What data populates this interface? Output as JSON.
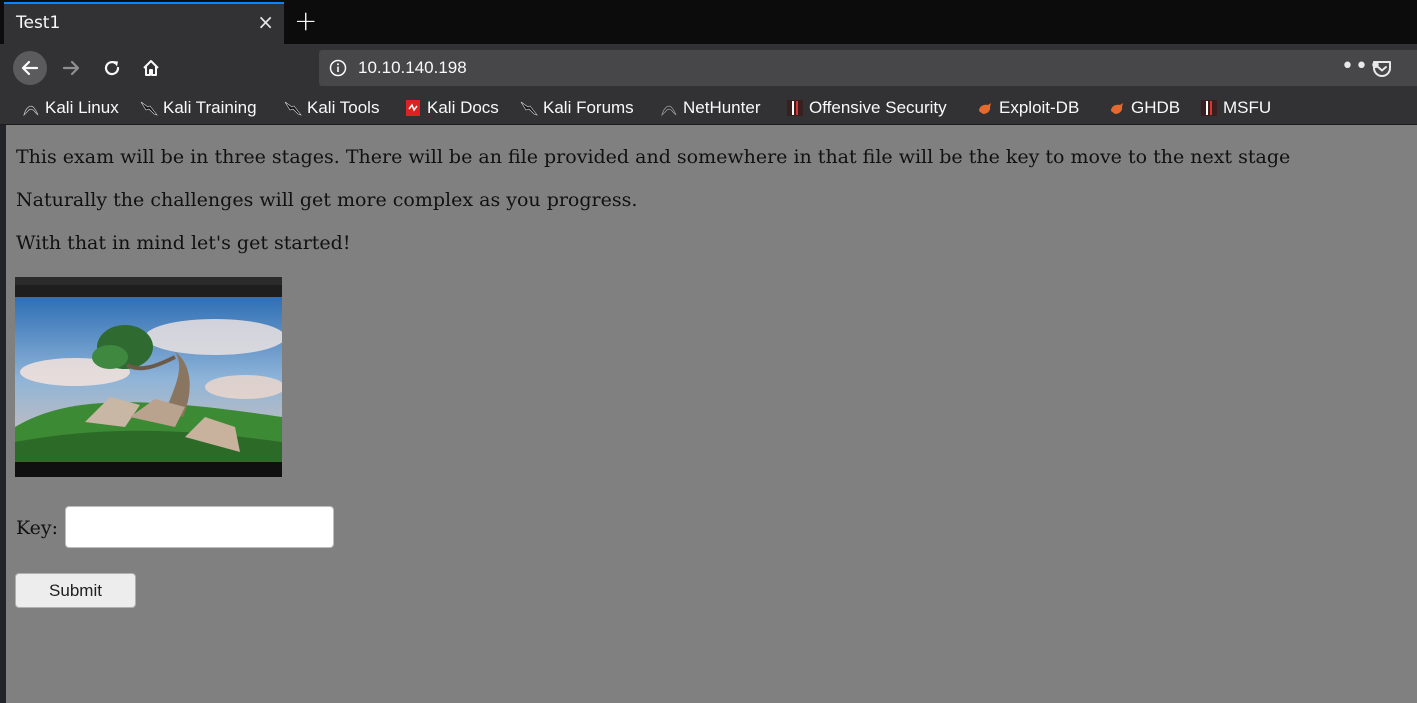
{
  "browser": {
    "tab": {
      "title": "Test1",
      "close_glyph": "×"
    },
    "new_tab_glyph": "+",
    "nav": {
      "back_icon": "back-arrow-icon",
      "forward_icon": "forward-arrow-icon",
      "reload_icon": "reload-icon",
      "home_icon": "home-icon"
    },
    "url": "10.10.140.198",
    "page_actions_glyph": "•••"
  },
  "bookmarks": [
    {
      "label": "Kali Linux",
      "icon": "kali-dragon-icon"
    },
    {
      "label": "Kali Training",
      "icon": "kali-dragon-icon"
    },
    {
      "label": "Kali Tools",
      "icon": "kali-dragon-icon"
    },
    {
      "label": "Kali Docs",
      "icon": "kali-docs-icon"
    },
    {
      "label": "Kali Forums",
      "icon": "kali-dragon-icon"
    },
    {
      "label": "NetHunter",
      "icon": "nethunter-icon"
    },
    {
      "label": "Offensive Security",
      "icon": "offsec-icon"
    },
    {
      "label": "Exploit-DB",
      "icon": "exploitdb-icon"
    },
    {
      "label": "GHDB",
      "icon": "exploitdb-icon"
    },
    {
      "label": "MSFU",
      "icon": "offsec-icon"
    }
  ],
  "page": {
    "paragraphs": [
      "This exam will be in three stages. There will be an file provided and somewhere in that file will be the key to move to the next stage",
      "Naturally the challenges will get more complex as you progress.",
      "With that in mind let's get started!"
    ],
    "image_icon": "landscape-screenshot-image",
    "key_label": "Key:",
    "key_value": "",
    "submit_label": "Submit"
  },
  "colors": {
    "page_background": "#808080",
    "toolbar": "#323234",
    "tab_accent": "#0a84ff"
  }
}
